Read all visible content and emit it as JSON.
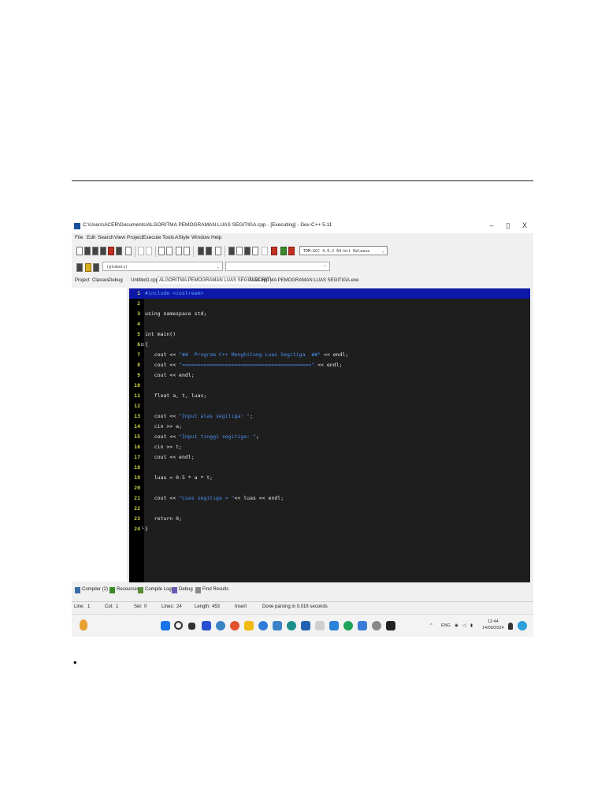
{
  "document": {
    "bullet": "•"
  },
  "window": {
    "title": "C:\\Users\\ACER\\Documents\\ALGORITMA PEMOGRAMAN LUAS SEGITIGA.cpp - [Executing] - Dev-C++ 5.11",
    "minimize": "–",
    "maximize": "▯",
    "close": "X"
  },
  "menu": [
    "File",
    "Edit",
    "Search",
    "View",
    "Project",
    "Execute",
    "Tools",
    "AStyle",
    "Window",
    "Help"
  ],
  "toolbar": {
    "compiler": "TDM-GCC 4.9.2 64-bit Release",
    "scope": "(globals)"
  },
  "panel_tabs": [
    "Project",
    "Classes",
    "Debug"
  ],
  "file_tabs": [
    "Untitled1.cpp",
    "ALGORITMA PEMOGRAMAN LUAS SEGITIGA.cpp",
    "ALGORITMA PEMOGRAMAN LUAS SEGITIGA.exe"
  ],
  "code_lines": [
    {
      "n": "1",
      "text": "#include <iostream>"
    },
    {
      "n": "2",
      "text": ""
    },
    {
      "n": "3",
      "text": "using namespace std;"
    },
    {
      "n": "4",
      "text": ""
    },
    {
      "n": "5",
      "text": "int main()"
    },
    {
      "n": "6",
      "text": "{"
    },
    {
      "n": "7",
      "pre": "   cout << ",
      "str": "\"##  Program C++ Menghitung Luas Segitiga  ##\"",
      "post": " << endl;"
    },
    {
      "n": "8",
      "pre": "   cout << ",
      "str": "\"==========================================\"",
      "post": " << endl;"
    },
    {
      "n": "9",
      "text": "   cout << endl;"
    },
    {
      "n": "10",
      "text": ""
    },
    {
      "n": "11",
      "text": "   float a, t, luas;"
    },
    {
      "n": "12",
      "text": ""
    },
    {
      "n": "13",
      "pre": "   cout << ",
      "str": "\"Input alas segitiga: \"",
      "post": ";"
    },
    {
      "n": "14",
      "text": "   cin >> a;"
    },
    {
      "n": "15",
      "pre": "   cout << ",
      "str": "\"Input tinggi segitiga: \"",
      "post": ";"
    },
    {
      "n": "16",
      "text": "   cin >> t;"
    },
    {
      "n": "17",
      "text": "   cout << endl;"
    },
    {
      "n": "18",
      "text": ""
    },
    {
      "n": "19",
      "text": "   luas = 0.5 * a * t;"
    },
    {
      "n": "20",
      "text": ""
    },
    {
      "n": "21",
      "pre": "   cout << ",
      "str": "\"Luas segitiga = \"",
      "post": "<< luas << endl;"
    },
    {
      "n": "22",
      "text": ""
    },
    {
      "n": "23",
      "text": "   return 0;"
    },
    {
      "n": "24",
      "text": "}"
    }
  ],
  "bottom_tabs": [
    "Compiler (2)",
    "Resources",
    "Compile Log",
    "Debug",
    "Find Results"
  ],
  "status": {
    "line_label": "Line:",
    "line": "1",
    "col_label": "Col:",
    "col": "1",
    "sel_label": "Sel:",
    "sel": "0",
    "lines_label": "Lines:",
    "lines": "24",
    "length_label": "Length:",
    "length": "453",
    "mode": "Insert",
    "message": "Done parsing in 0,016 seconds"
  },
  "taskbar": {
    "lang": "ENG",
    "time": "12:44",
    "date": "14/06/2024",
    "up_arrow": "^"
  }
}
